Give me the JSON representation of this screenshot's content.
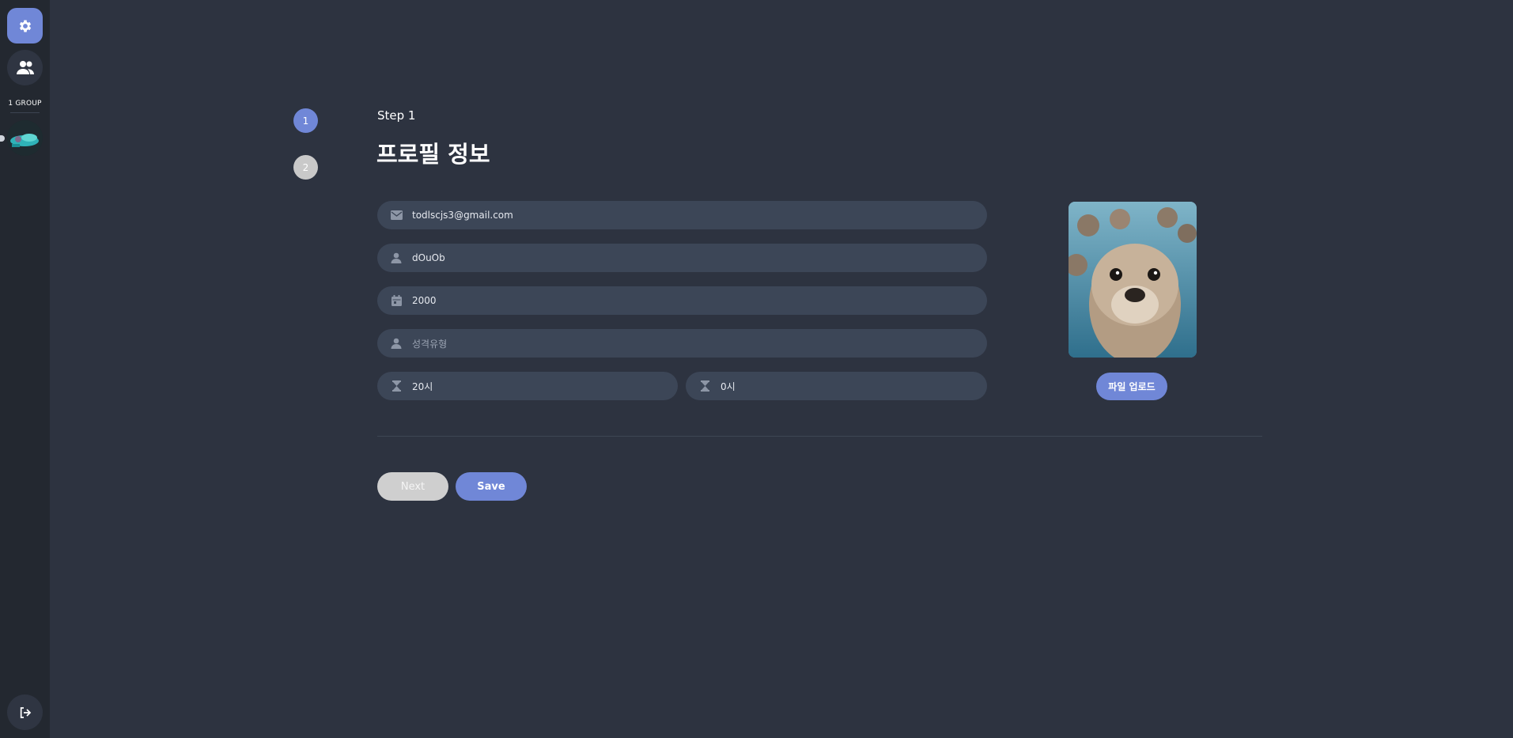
{
  "sidebar": {
    "group_label": "1 GROUP",
    "icons": {
      "settings": "gear-icon",
      "people": "users-icon",
      "logout": "logout-icon"
    }
  },
  "stepper": {
    "steps": [
      "1",
      "2"
    ],
    "active_step": "1"
  },
  "header": {
    "step_label": "Step 1",
    "title": "프로필 정보"
  },
  "form": {
    "email": {
      "value": "todlscjs3@gmail.com",
      "icon": "envelope-icon"
    },
    "nickname": {
      "value": "dOuOb",
      "icon": "user-icon"
    },
    "birth_year": {
      "value": "2000",
      "icon": "calendar-icon"
    },
    "personality": {
      "value": "",
      "placeholder": "성격유형",
      "icon": "user-icon"
    },
    "time_start": {
      "value": "20시",
      "icon": "hourglass-icon"
    },
    "time_end": {
      "value": "0시",
      "icon": "hourglass-icon"
    }
  },
  "photo": {
    "upload_label": "파일 업로드"
  },
  "actions": {
    "next_label": "Next",
    "save_label": "Save"
  },
  "colors": {
    "accent": "#7087d7",
    "background": "#2d3340",
    "sidebar": "#232830",
    "field": "#3c4657",
    "disabled": "#cfcfcf"
  }
}
